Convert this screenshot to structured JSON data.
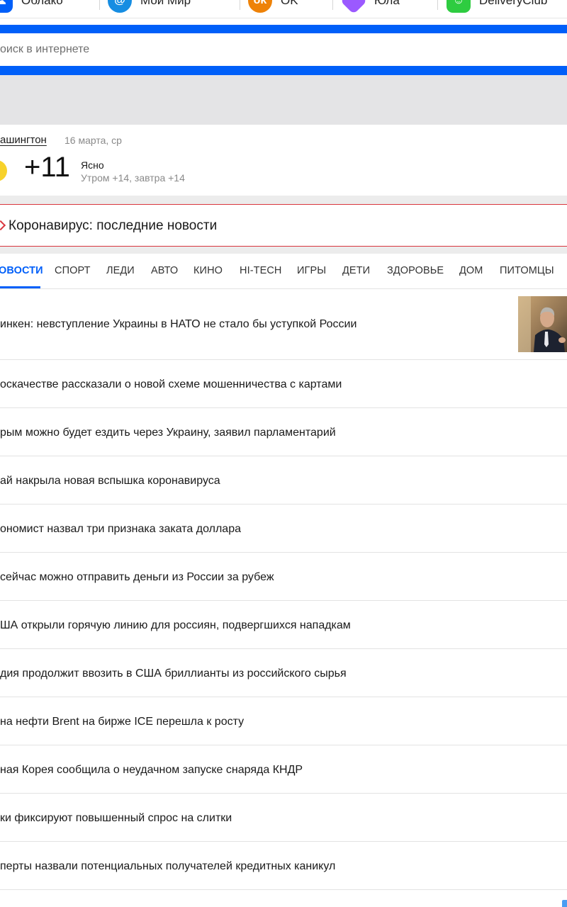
{
  "services": [
    {
      "label": "Облако",
      "icon": "cloud-icon",
      "color": "#005ff9"
    },
    {
      "label": "Мой Мир",
      "icon": "moimir-icon",
      "color": "#168de2"
    },
    {
      "label": "OK",
      "icon": "ok-icon",
      "color": "#ee8208"
    },
    {
      "label": "Юла",
      "icon": "yula-icon",
      "color": "#9b59ff"
    },
    {
      "label": "DeliveryClub",
      "icon": "deliveryclub-icon",
      "color": "#2ecc40"
    }
  ],
  "search": {
    "placeholder": "оиск в интернете",
    "accent": "#005ff9"
  },
  "weather": {
    "city": "ашингтон",
    "date": "16 марта, ср",
    "temp": "+11",
    "condition": "Ясно",
    "forecast": "Утром +14, завтра +14",
    "icon": "moon-icon"
  },
  "covid_banner": {
    "text": "Коронавирус: последние новости",
    "color": "#d9363e"
  },
  "tabs": [
    {
      "label": "ОВОСТИ",
      "active": true
    },
    {
      "label": "СПОРТ"
    },
    {
      "label": "ЛЕДИ"
    },
    {
      "label": "АВТО"
    },
    {
      "label": "КИНО"
    },
    {
      "label": "HI-TECH"
    },
    {
      "label": "ИГРЫ"
    },
    {
      "label": "ДЕТИ"
    },
    {
      "label": "ЗДОРОВЬЕ"
    },
    {
      "label": "ДОМ"
    },
    {
      "label": "ПИТОМЦЫ"
    }
  ],
  "news": [
    {
      "title": "инкен: невступление Украины в НАТО не стало бы уступкой России",
      "has_photo": true
    },
    {
      "title": "оскачестве рассказали о новой схеме мошенничества с картами"
    },
    {
      "title": "рым можно будет ездить через Украину, заявил парламентарий"
    },
    {
      "title": "ай накрыла новая вспышка коронавируса"
    },
    {
      "title": "ономист назвал три признака заката доллара"
    },
    {
      "title": "сейчас можно отправить деньги из России за рубеж"
    },
    {
      "title": "ША открыли горячую линию для россиян, подвергшихся нападкам"
    },
    {
      "title": "дия продолжит ввозить в США бриллианты из российского сырья"
    },
    {
      "title": "на нефти Brent на бирже ICE перешла к росту"
    },
    {
      "title": "ная Корея сообщила о неудачном запуске снаряда КНДР"
    },
    {
      "title": "ки фиксируют повышенный спрос на слитки"
    },
    {
      "title": "перты назвали потенциальных получателей кредитных каникул"
    }
  ]
}
